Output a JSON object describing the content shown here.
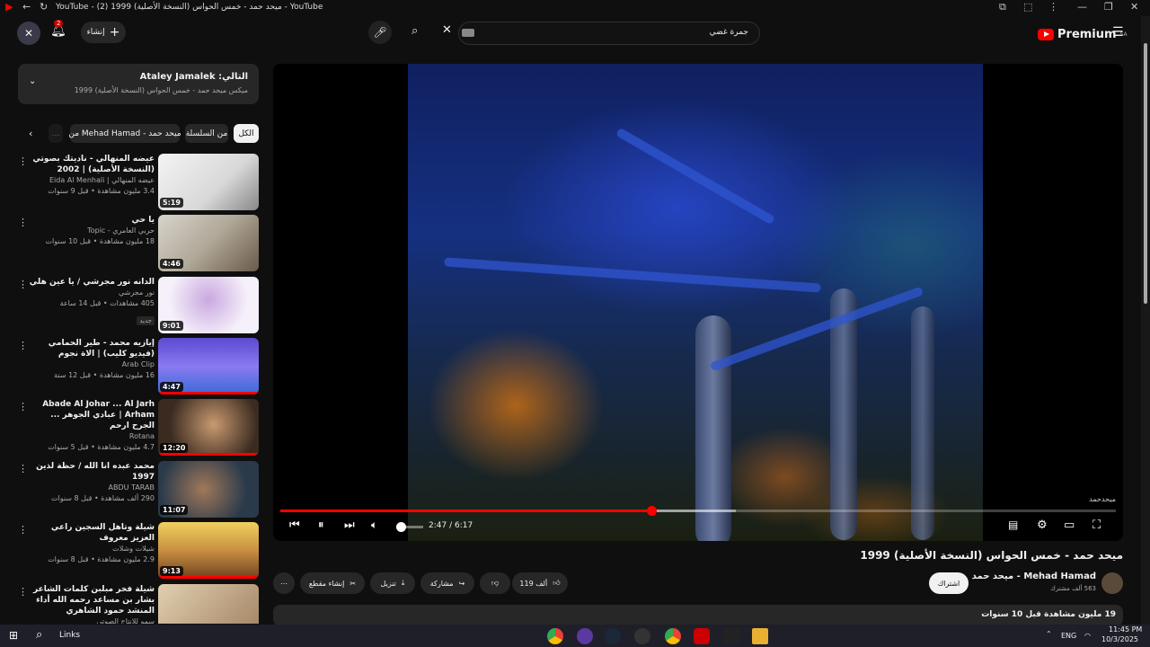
{
  "window": {
    "title": "YouTube - (2) ميحد حمد - خمس الحواس (النسخة الأصلية) 1999 - YouTube"
  },
  "masthead": {
    "search_value": "جمرة غضي",
    "create_label": "إنشاء",
    "notif_count": "2",
    "logo": "Premium",
    "logo_region": "SA"
  },
  "sidebar": {
    "next_label": "التالي: Ataley Jamalek",
    "next_sub": "ميكس ميحد حمد - خمس الحواس (النسخة الأصلية) 1999",
    "chips": [
      "الكل",
      "من السلسلة",
      "من Mehad Hamad - ميحد حمد"
    ],
    "items": [
      {
        "title": "عيضه المنهالي - ناديتك بصوتي (النسخة الأصلية) | 2002",
        "channel": "عيضه المنهالي | Eida Al Menhali",
        "meta": "3.4 مليون مشاهدة • قبل 9 سنوات",
        "duration": "5:19"
      },
      {
        "title": "يا حي",
        "channel": "حربي العامري - Topic",
        "meta": "18 مليون مشاهدة • قبل 10 سنوات",
        "duration": "4:46"
      },
      {
        "title": "الدانه نور مجرشي / يا عين هلي",
        "channel": "نور مجرشي",
        "meta": "405 مشاهدات • قبل 14 ساعة",
        "badge": "جديد",
        "duration": "9:01"
      },
      {
        "title": "إيازيه محمد - طير الحمامي (فيديو كليب) | الاة نجوم",
        "channel": "Arab Clip",
        "meta": "16 مليون مشاهدة • قبل 12 سنة",
        "duration": "4:47"
      },
      {
        "title": "Abade Al Johar ... Al Jarh Arham | عبادي الجوهر ... الجرح ارحم",
        "channel": "Rotana",
        "meta": "4.7 مليون مشاهدة • قبل 5 سنوات",
        "duration": "12:20"
      },
      {
        "title": "محمد عبده  انا الله / حظة  لذين 1997",
        "channel": "ABDU TARAB",
        "meta": "290 ألف مشاهدة • قبل 8 سنوات",
        "duration": "11:07"
      },
      {
        "title": "شيلة وتاهل السجين راعي العزيز معروف",
        "channel": "شيلات وشلات",
        "meta": "2.9 مليون مشاهدة • قبل 8 سنوات",
        "duration": "9:13"
      },
      {
        "title": "شيلة فخر مبلبن كلمات الشاعر بشار بن مساعد رحمه الله أداء المنشد حمود الشاهري",
        "channel": "سمو للإنتاج الصوتي",
        "meta": "",
        "duration": ""
      }
    ]
  },
  "player": {
    "time": "2:47 / 6:17",
    "progress": 0.444,
    "buffered": 0.545,
    "watermark": "ميحدحمد"
  },
  "video": {
    "title": "ميحد حمد - خمس الحواس (النسخة الأصلية) 1999",
    "channel": "Mehad Hamad - ميحد حمد",
    "subs": "563 ألف مشترك",
    "subscribe": "اشتراك",
    "likes": "119 ألف",
    "share": "مشاركة",
    "download": "تنزيل",
    "clip": "إنشاء مقطع",
    "desc": "19 مليون مشاهدة  قبل 10 سنوات"
  },
  "taskbar": {
    "links": "Links",
    "lang": "ENG",
    "time": "11:45 PM",
    "date": "10/3/2025"
  }
}
